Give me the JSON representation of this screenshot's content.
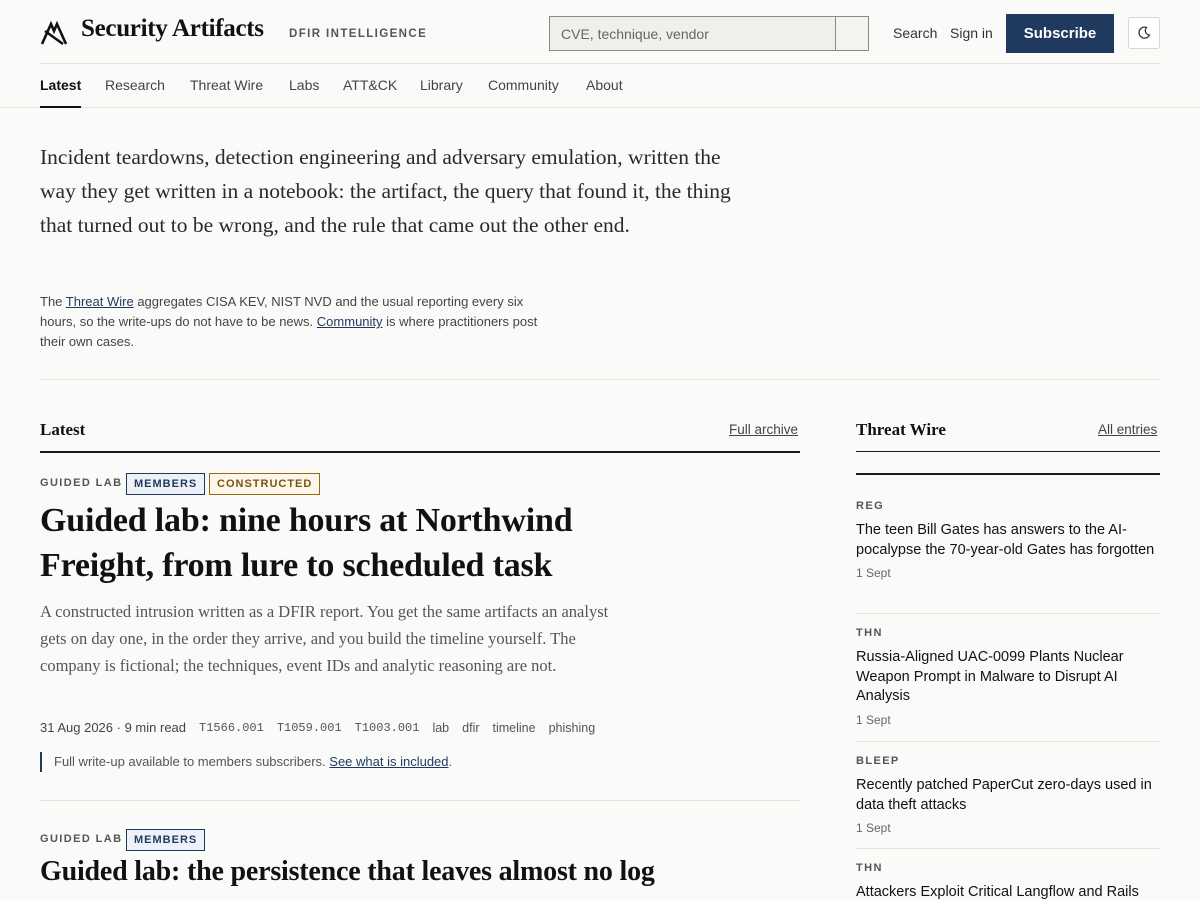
{
  "header": {
    "brand": "Security Artifacts",
    "tagline": "DFIR INTELLIGENCE",
    "search_placeholder": "CVE, technique, vendor",
    "search_label": "Search",
    "signin_label": "Sign in",
    "subscribe_label": "Subscribe",
    "accent_color": "#1f3a5e"
  },
  "nav": {
    "items": [
      {
        "label": "Latest",
        "active": true
      },
      {
        "label": "Research"
      },
      {
        "label": "Threat Wire"
      },
      {
        "label": "Labs"
      },
      {
        "label": "ATT&CK"
      },
      {
        "label": "Library"
      },
      {
        "label": "Community"
      },
      {
        "label": "About"
      }
    ]
  },
  "intro": {
    "lead": "Incident teardowns, detection engineering and adversary emulation, written the way they get written in a notebook: the artifact, the query that found it, the thing that turned out to be wrong, and the rule that came out the other end.",
    "sub_prefix": "The",
    "sub_link1": "Threat Wire",
    "sub_mid": "aggregates CISA KEV, NIST NVD and the usual reporting every six hours, so the write-ups do not have to be news.",
    "sub_link2": "Community",
    "sub_suffix": "is where practitioners post their own cases."
  },
  "latest": {
    "heading": "Latest",
    "archive_link": "Full archive",
    "articles": [
      {
        "kicker": "GUIDED LAB",
        "badges": [
          "MEMBERS",
          "CONSTRUCTED"
        ],
        "title_line1": "Guided lab: nine hours at Northwind",
        "title_line2": "Freight, from lure to scheduled task",
        "dek": "A constructed intrusion written as a DFIR report. You get the same artifacts an analyst gets on day one, in the order they arrive, and you build the timeline yourself. The company is fictional; the techniques, event IDs and analytic reasoning are not.",
        "date": "31 Aug 2026",
        "read_time": "9 min read",
        "techniques": [
          "T1566.001",
          "T1059.001",
          "T1003.001"
        ],
        "tags": [
          "lab",
          "dfir",
          "timeline",
          "phishing"
        ],
        "note_text": "Full write-up available to members subscribers.",
        "note_link": "See what is included"
      },
      {
        "kicker": "GUIDED LAB",
        "badges": [
          "MEMBERS"
        ],
        "title_line1": "Guided lab: the persistence that leaves almost no log"
      }
    ]
  },
  "threat_wire": {
    "heading": "Threat Wire",
    "all_link": "All entries",
    "items": [
      {
        "source": "REG",
        "title": "The teen Bill Gates has answers to the AI-pocalypse the 70-year-old Gates has forgotten",
        "date": "1 Sept"
      },
      {
        "source": "THN",
        "title": "Russia-Aligned UAC-0099 Plants Nuclear Weapon Prompt in Malware to Disrupt AI Analysis",
        "date": "1 Sept"
      },
      {
        "source": "BLEEP",
        "title": "Recently patched PaperCut zero-days used in data theft attacks",
        "date": "1 Sept"
      },
      {
        "source": "THN",
        "title": "Attackers Exploit Critical Langflow and Rails"
      }
    ]
  }
}
